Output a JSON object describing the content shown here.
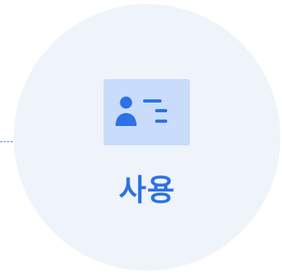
{
  "step": {
    "label": "사용",
    "icon": "id-card-icon"
  },
  "colors": {
    "circle_fill": "#eff3fa",
    "card_fill": "#c9dcfb",
    "accent": "#2c72e6",
    "connector": "#5b8fe8"
  }
}
